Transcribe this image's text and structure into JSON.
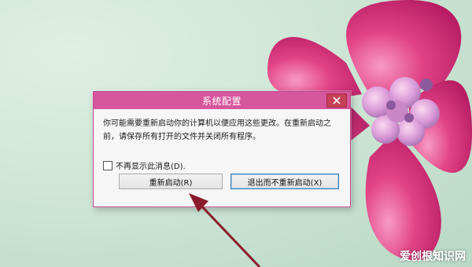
{
  "dialog": {
    "title": "系统配置",
    "message": "你可能需要重新启动你的计算机以便应用这些更改。在重新启动之前，请保存所有打开的文件并关闭所有程序。",
    "checkbox_label": "不再显示此消息(D).",
    "checkbox_checked": false,
    "buttons": {
      "restart": "重新启动(R)",
      "exit_without_restart": "退出而不重新启动(X)"
    }
  },
  "watermark": "爱创根知识网",
  "colors": {
    "titlebar": "#d7579e",
    "close_button": "#c64156",
    "flower_petal": "#e24385",
    "arrow": "#8a1b2c"
  },
  "icons": [
    "close-icon",
    "flower-wallpaper",
    "arrow-annotation"
  ]
}
